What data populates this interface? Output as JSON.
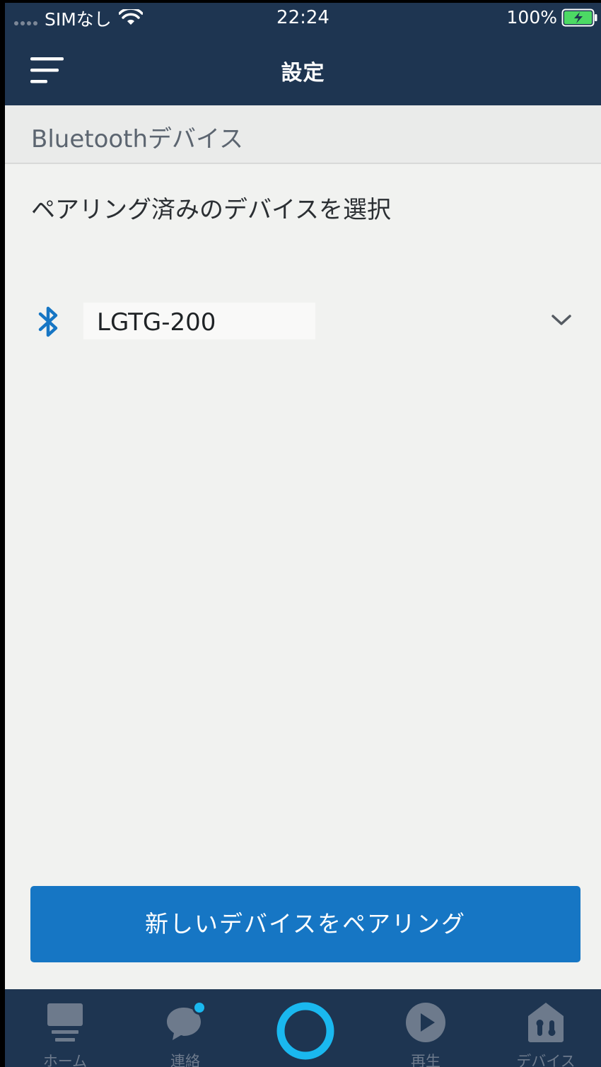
{
  "status_bar": {
    "carrier": "SIMなし",
    "time": "22:24",
    "battery": "100%"
  },
  "header": {
    "title": "設定"
  },
  "section": {
    "title": "Bluetoothデバイス"
  },
  "select_label": "ペアリング済みのデバイスを選択",
  "device": {
    "name": "LGTG-200"
  },
  "pair_button_label": "新しいデバイスをペアリング",
  "tabs": [
    {
      "label": "ホーム",
      "icon": "home-icon"
    },
    {
      "label": "連絡",
      "icon": "chat-bubble-icon"
    },
    {
      "label": "",
      "icon": "alexa-icon"
    },
    {
      "label": "再生",
      "icon": "play-icon"
    },
    {
      "label": "デバイス",
      "icon": "devices-house-icon"
    }
  ],
  "colors": {
    "navy": "#1e3551",
    "accent_blue": "#1676c4",
    "alexa_cyan": "#1ab8ef",
    "background": "#f1f2f0",
    "tab_inactive": "#6d7a8c"
  }
}
